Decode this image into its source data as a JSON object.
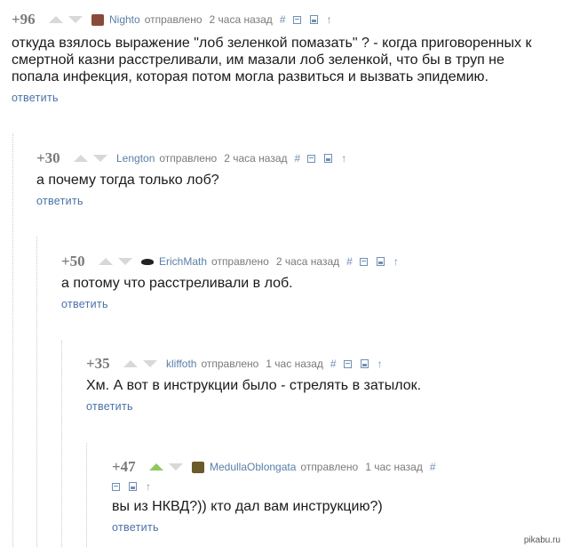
{
  "comments": [
    {
      "rating": "+96",
      "author": "Nighto",
      "sent": "отправлено",
      "time": "2 часа назад",
      "text_lines": [
        "откуда взялось выражение \"лоб зеленкой помазать\" ? - когда приговоренных к",
        "смертной казни расстреливали, им мазали лоб зеленкой, что бы в труп не",
        "попала инфекция, которая потом могла развиться и вызвать эпидемию."
      ],
      "reply": "ответить",
      "avatar_color": "#8a4a3a"
    },
    {
      "rating": "+30",
      "author": "Lengton",
      "sent": "отправлено",
      "time": "2 часа назад",
      "text_lines": [
        "а почему тогда только лоб?"
      ],
      "reply": "ответить"
    },
    {
      "rating": "+50",
      "author": "ErichMath",
      "sent": "отправлено",
      "time": "2 часа назад",
      "text_lines": [
        "а потому что расстреливали в лоб."
      ],
      "reply": "ответить",
      "avatar_color": "#222222"
    },
    {
      "rating": "+35",
      "author": "kliffoth",
      "sent": "отправлено",
      "time": "1 час назад",
      "text_lines": [
        "Хм. А вот в инструкции было - стрелять в затылок."
      ],
      "reply": "ответить"
    },
    {
      "rating": "+47",
      "author": "MedullaOblongata",
      "sent": "отправлено",
      "time": "1 час назад",
      "text_lines": [
        "вы из НКВД?)) кто дал вам инструкцию?)"
      ],
      "reply": "ответить",
      "avatar_color": "#6b5a2a",
      "upvoted": true
    }
  ],
  "icons": {
    "hash": "#",
    "up": "↑"
  },
  "watermark": "pikabu.ru"
}
